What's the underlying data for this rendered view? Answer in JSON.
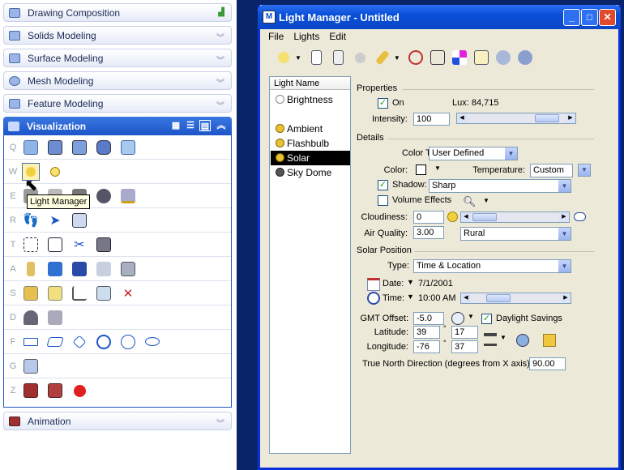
{
  "left_panel": {
    "categories_top": [
      {
        "label": "Drawing Composition",
        "icon": "drawing-composition-icon"
      },
      {
        "label": "Solids Modeling",
        "icon": "solids-icon"
      },
      {
        "label": "Surface Modeling",
        "icon": "surface-icon"
      },
      {
        "label": "Mesh Modeling",
        "icon": "mesh-icon"
      },
      {
        "label": "Feature Modeling",
        "icon": "feature-icon"
      }
    ],
    "visualization": {
      "label": "Visualization"
    },
    "row_keys": [
      "Q",
      "W",
      "E",
      "R",
      "T",
      "A",
      "S",
      "D",
      "F",
      "G",
      "Z"
    ],
    "tooltip": "Light Manager",
    "animation": {
      "label": "Animation"
    }
  },
  "window": {
    "title": "Light Manager - Untitled",
    "menu": [
      "File",
      "Lights",
      "Edit"
    ],
    "list_header": "Light Name",
    "lights": [
      "Brightness",
      "Ambient",
      "Flashbulb",
      "Solar",
      "Sky Dome"
    ],
    "selected_light": "Solar",
    "properties": {
      "section": "Properties",
      "on_label": "On",
      "on_checked": true,
      "lux_label": "Lux: 84,715",
      "intensity_label": "Intensity:",
      "intensity_value": "100"
    },
    "details": {
      "section": "Details",
      "color_type_label": "Color Type:",
      "color_type_value": "User Defined",
      "color_label": "Color:",
      "temperature_label": "Temperature:",
      "temperature_value": "Custom",
      "shadow_label": "Shadow:",
      "shadow_checked": true,
      "shadow_value": "Sharp",
      "volume_label": "Volume Effects",
      "volume_checked": false,
      "cloudiness_label": "Cloudiness:",
      "cloudiness_value": "0",
      "air_quality_label": "Air Quality:",
      "air_quality_value": "3.00",
      "air_quality_select": "Rural"
    },
    "solar": {
      "section": "Solar Position",
      "type_label": "Type:",
      "type_value": "Time & Location",
      "date_label": "Date:",
      "date_value": "7/1/2001",
      "time_label": "Time:",
      "time_value": "10:00 AM",
      "gmt_label": "GMT Offset:",
      "gmt_value": "-5.0",
      "dst_label": "Daylight Savings",
      "dst_checked": true,
      "latitude_label": "Latitude:",
      "latitude_deg": "39",
      "latitude_min": "17",
      "longitude_label": "Longitude:",
      "longitude_deg": "-76",
      "longitude_min": "37",
      "north_label": "True North Direction (degrees from X axis):",
      "north_value": "90.00",
      "degree_symbol": "°"
    }
  }
}
